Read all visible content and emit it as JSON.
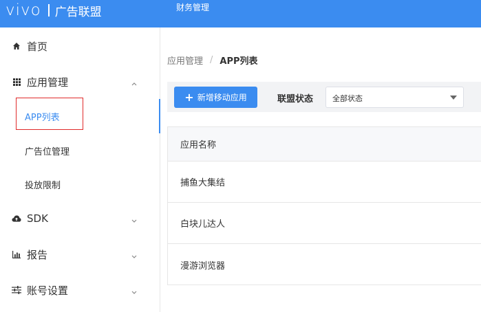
{
  "header": {
    "logo": "vivo",
    "product": "广告联盟",
    "nav_item": "财务管理",
    "bg_color": "#3b8cf0"
  },
  "sidebar": {
    "items": [
      {
        "label": "首页",
        "icon": "home-icon"
      },
      {
        "label": "应用管理",
        "icon": "grid-icon",
        "expanded": true,
        "children": [
          {
            "label": "APP列表",
            "active": true
          },
          {
            "label": "广告位管理"
          },
          {
            "label": "投放限制"
          }
        ]
      },
      {
        "label": "SDK",
        "icon": "cloud-upload-icon",
        "expanded": false
      },
      {
        "label": "报告",
        "icon": "bar-chart-icon",
        "expanded": false
      },
      {
        "label": "账号设置",
        "icon": "sliders-icon",
        "expanded": false
      }
    ]
  },
  "breadcrumb": {
    "parent": "应用管理",
    "separator": "/",
    "current": "APP列表"
  },
  "toolbar": {
    "add_button": "新增移动应用",
    "status_label": "联盟状态",
    "status_select": "全部状态"
  },
  "table": {
    "header": "应用名称",
    "rows": [
      "捕鱼大集结",
      "白块儿达人",
      "漫游浏览器"
    ]
  },
  "colors": {
    "accent": "#3b8cf0",
    "highlight_box": "#e02a2a"
  }
}
